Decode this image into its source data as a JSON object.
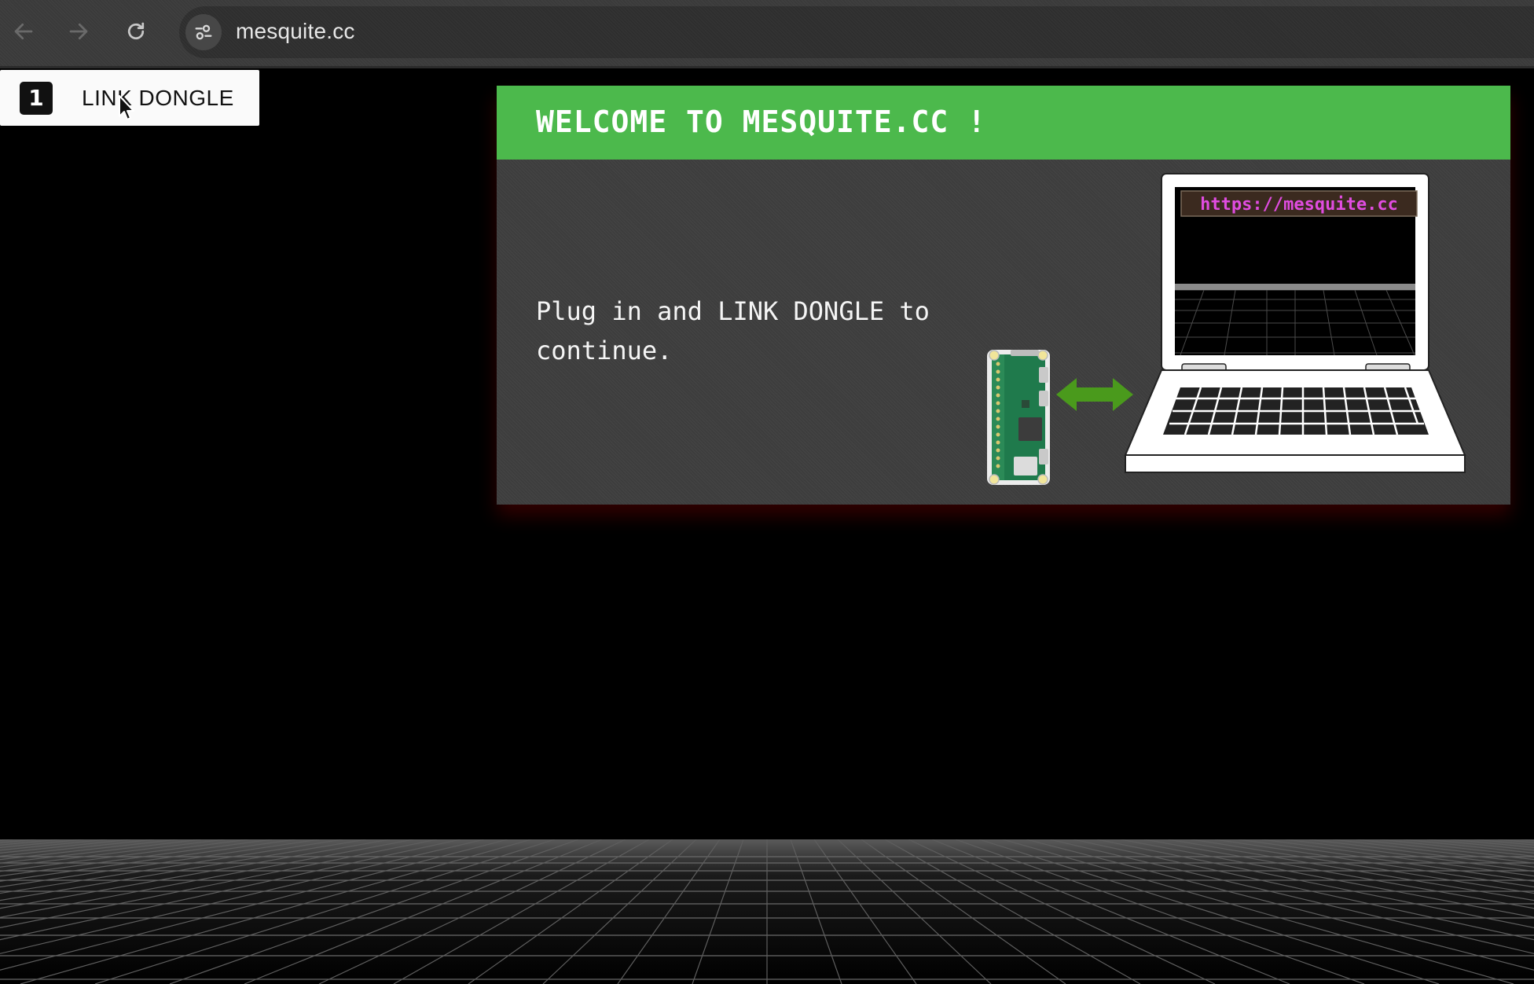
{
  "browser": {
    "url": "mesquite.cc",
    "icons": {
      "back": "arrow-left-icon",
      "forward": "arrow-right-icon",
      "reload": "reload-icon",
      "site_info": "tune-icon"
    }
  },
  "link_button": {
    "step_number": "1",
    "label": "LINK DONGLE"
  },
  "panel": {
    "title": "WELCOME TO MESQUITE.CC !",
    "message": "Plug in and LINK DONGLE to continue.",
    "laptop_screen_url": "https://mesquite.cc",
    "header_color": "#4cb94c",
    "arrow_color": "#4a9a1c",
    "url_color": "#e04ce0"
  }
}
